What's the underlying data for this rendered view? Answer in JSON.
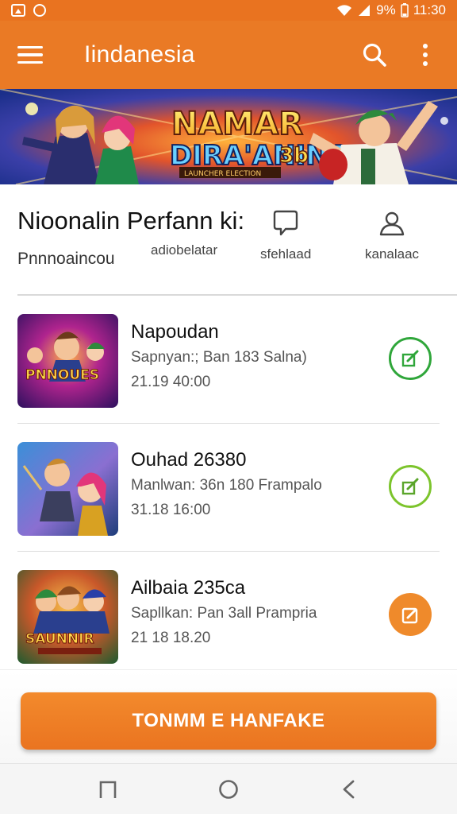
{
  "status_bar": {
    "battery": "9%",
    "time": "11:30"
  },
  "app_bar": {
    "title": "Iindanesia"
  },
  "banner": {
    "title_line1": "NAMAR",
    "title_line2": "DIRA'ANINA",
    "badge": "3b",
    "tagline": "LAUNCHER ELECTION"
  },
  "section": {
    "title": "Nioonalin Perfann  ki:",
    "subtitle": "Pnnnoaincou",
    "columns": [
      {
        "label": "adiobelatar",
        "icon": ""
      },
      {
        "label": "sfehlaad",
        "icon": "chat-bubble-icon"
      },
      {
        "label": "kanalaac",
        "icon": "user-icon"
      }
    ]
  },
  "items": [
    {
      "title": "Napoudan",
      "subtitle": "Sapnyan:; Ban 183 Salna)",
      "time": "21.19 40:00",
      "thumb_text": "PNNOUES",
      "action_style": "outline-green"
    },
    {
      "title": "Ouhad 26380",
      "subtitle": "Manlwan: 36n 180 Frampalo",
      "time": "31.18 16:00",
      "thumb_text": "",
      "action_style": "outline-lime"
    },
    {
      "title": "Ailbaia 235ca",
      "subtitle": "Sapllkan: Pan 3all Prampria",
      "time": "21 18 18.20",
      "thumb_text": "SAUNNIR",
      "action_style": "filled-orange"
    }
  ],
  "primary_button": {
    "label": "TONMM E  HANFAKE"
  },
  "colors": {
    "accent": "#ea7a25",
    "green": "#2fa63a",
    "lime": "#7cc42c",
    "orange": "#ef8a2b"
  }
}
